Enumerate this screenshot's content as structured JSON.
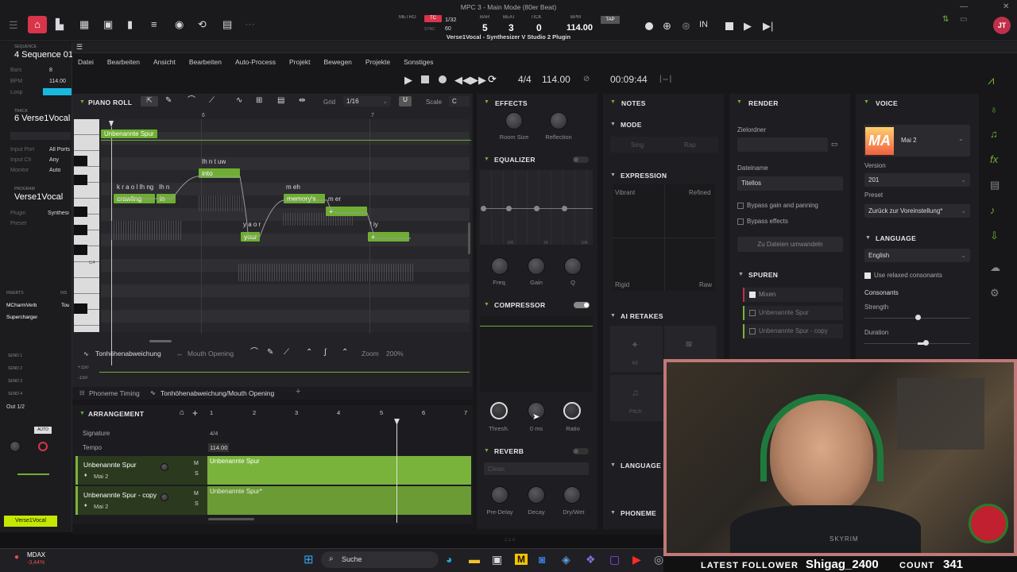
{
  "mpc": {
    "title": "MPC 3 - Main Mode (80er Beat)",
    "plugin_title": "Verse1Vocal - Synthesizer V Studio 2 Plugin",
    "metro": "METRO",
    "tc": "TC",
    "grid": "1/32",
    "bar": "5",
    "beat": "3",
    "tick": "0",
    "bpm": "114.00",
    "bar_lbl": "BAR",
    "beat_lbl": "BEAT",
    "tick_lbl": "TICK",
    "bpm_lbl": "BPM",
    "tap": "TAP",
    "sync_lbl": "SYNC",
    "sync_val": "60",
    "avatar": "JT"
  },
  "left": {
    "seq_lbl": "SEQUENCE",
    "seq": "4 Sequence 01",
    "bars_lbl": "Bars",
    "bars": "8",
    "bpm_lbl": "BPM",
    "bpm": "114.00",
    "loop_lbl": "Loop",
    "track_lbl": "TRACK",
    "track": "6 Verse1Vocal",
    "input_port_lbl": "Input Port",
    "input_port": "All Ports",
    "input_ch_lbl": "Input Ch",
    "input_ch": "Any",
    "monitor_lbl": "Monitor",
    "monitor": "Auto",
    "program_lbl": "PROGRAM",
    "program": "Verse1Vocal",
    "plugin_lbl": "Plugin",
    "plugin": "Synthesi",
    "preset_lbl": "Preset",
    "inserts_lbl": "INSERTS",
    "insert1": "MCharmVerb",
    "insert2": "Supercharger",
    "insert3": "Tou",
    "insert_hdr2": "INS",
    "sends": [
      "SEND 1",
      "SEND 2",
      "SEND 3",
      "SEND 4"
    ],
    "out": "Out 1/2",
    "auto": "AUTO",
    "bottom_track": "Verse1Vocal"
  },
  "menu": [
    "Datei",
    "Bearbeiten",
    "Ansicht",
    "Bearbeiten",
    "Auto-Process",
    "Projekt",
    "Bewegen",
    "Projekte",
    "Sonstiges"
  ],
  "transport": {
    "timesig": "4/4",
    "tempo": "114.00",
    "time": "00:09:44"
  },
  "piano_roll": {
    "title": "PIANO ROLL",
    "grid_lbl": "Grid",
    "grid": "1/16",
    "scale_lbl": "Scale",
    "scale": "C",
    "bar6": "6",
    "bar7": "7",
    "track_label": "Unbenannte Spur",
    "c4": "C4",
    "notes": [
      {
        "ph": "k r a o l Ih ng",
        "txt": "crawling"
      },
      {
        "ph": "Ih n",
        "txt": "in"
      },
      {
        "ph": "Ih n t uw",
        "txt": "into"
      },
      {
        "ph": "m eh",
        "txt": "memory's"
      },
      {
        "ph": "m er",
        "txt": "+"
      },
      {
        "ph": "y a o r",
        "txt": "your"
      },
      {
        "ph": "l iy",
        "txt": "+"
      }
    ]
  },
  "param": {
    "tab1": "Tonhöhenabweichung",
    "tab2": "Mouth Opening",
    "zoom_lbl": "Zoom",
    "zoom": "200%",
    "v1": "+150",
    "v2": "-150"
  },
  "bottom_tabs": {
    "t1": "Phoneme Timing",
    "t2": "Tonhöhenabweichung/Mouth Opening"
  },
  "arrangement": {
    "title": "ARRANGEMENT",
    "signature_lbl": "Signature",
    "signature": "4/4",
    "tempo_lbl": "Tempo",
    "tempo": "114.00",
    "bars": [
      "1",
      "2",
      "3",
      "4",
      "5",
      "6",
      "7"
    ],
    "tracks": [
      {
        "name": "Unbenannte Spur",
        "voice": "Mai 2",
        "clip": "Unbenannte Spur"
      },
      {
        "name": "Unbenannte Spur - copy",
        "voice": "Mai 2",
        "clip": "Unbenannte Spur*"
      }
    ]
  },
  "effects": {
    "title": "EFFECTS",
    "room_size": "Room Size",
    "reflection": "Reflection",
    "eq": "EQUALIZER",
    "eq_f1": "100",
    "eq_f2": "1K",
    "eq_f3": "10K",
    "freq": "Freq.",
    "gain": "Gain",
    "q": "Q",
    "compressor": "COMPRESSOR",
    "thresh": "Thresh.",
    "attack": "0 ms",
    "ratio": "Ratio",
    "reverb": "REVERB",
    "reverb_type": "Clean",
    "predelay": "Pre-Delay",
    "decay": "Decay",
    "drywet": "Dry/Wet",
    "footer": "2.1.0"
  },
  "notes": {
    "title": "NOTES",
    "mode": "MODE",
    "sing": "Sing",
    "rap": "Rap",
    "expression": "EXPRESSION",
    "vibrant": "Vibrant",
    "refined": "Refined",
    "rigid": "Rigid",
    "raw": "Raw",
    "ai_retakes": "AI RETAKES",
    "all": "All",
    "pitch": "Pitch",
    "language": "LANGUAGE",
    "phoneme": "PHONEME"
  },
  "render": {
    "title": "RENDER",
    "folder_lbl": "Zielordner",
    "filename_lbl": "Dateiname",
    "filename": "Titellos",
    "bypass_gain": "Bypass gain and panning",
    "bypass_fx": "Bypass effects",
    "convert": "Zu Dateien umwandeln",
    "tracks_title": "SPUREN",
    "mix": "Mixen",
    "track1": "Unbenannte Spur",
    "track2": "Unbenannte Spur - copy"
  },
  "voice": {
    "title": "VOICE",
    "name": "Mai 2",
    "logo": "MA",
    "version_lbl": "Version",
    "version": "201",
    "preset_lbl": "Preset",
    "preset": "Zurück zur Voreinstellung*",
    "language_title": "LANGUAGE",
    "language": "English",
    "relaxed": "Use relaxed consonants",
    "consonants": "Consonants",
    "strength": "Strength",
    "duration": "Duration"
  },
  "taskbar": {
    "search": "Suche",
    "stock": "MDAX",
    "stock_change": "-3,44%"
  },
  "stream": {
    "latest": "LATEST FOLLOWER",
    "follower": "Shigag_2400",
    "count_lbl": "COUNT",
    "count": "341",
    "shirt": "SKYRIM"
  }
}
